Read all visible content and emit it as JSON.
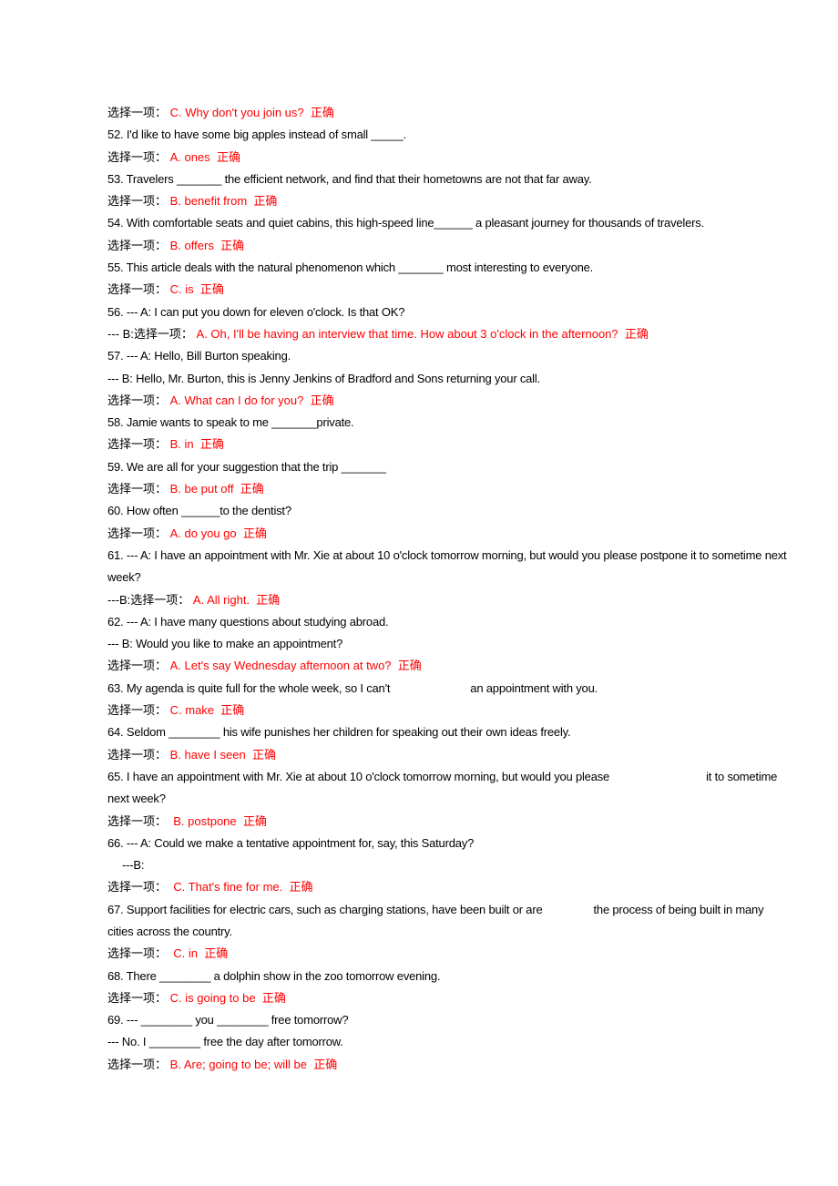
{
  "document": {
    "language_label": "选择一项：",
    "correct_mark": "正确",
    "accent_color": "#ff0000",
    "text_color": "#000000",
    "background_color": "#ffffff"
  },
  "lines": [
    {
      "id": "answer-51",
      "type": "answer",
      "label": "选择一项：",
      "answer": "C. Why don't you join us?",
      "mark": "正确"
    },
    {
      "id": "question-52",
      "type": "question",
      "text": "52. I'd like to have some big apples instead of small _____."
    },
    {
      "id": "answer-52",
      "type": "answer",
      "label": "选择一项：",
      "answer": "A. ones",
      "mark": "正确"
    },
    {
      "id": "question-53",
      "type": "question",
      "text": "53. Travelers _______ the efficient network, and find that their hometowns are not that far away."
    },
    {
      "id": "answer-53",
      "type": "answer",
      "label": "选择一项：",
      "answer": "B. benefit from",
      "mark": "正确"
    },
    {
      "id": "question-54",
      "type": "question",
      "text": "54. With comfortable seats and quiet cabins, this high-speed line______ a pleasant journey for thousands of travelers."
    },
    {
      "id": "answer-54",
      "type": "answer",
      "label": "选择一项：",
      "answer": "B. offers",
      "mark": "正确"
    },
    {
      "id": "question-55",
      "type": "question",
      "text": "55. This article deals with the natural phenomenon which _______ most interesting to everyone."
    },
    {
      "id": "answer-55",
      "type": "answer",
      "label": "选择一项：",
      "answer": "C. is",
      "mark": "正确"
    },
    {
      "id": "question-56",
      "type": "question",
      "text": "56. --- A: I can put you down for eleven o'clock. Is that OK?"
    },
    {
      "id": "answer-56",
      "type": "answer-dialog",
      "prefix": "--- B:",
      "label": "选择一项：",
      "answer": "A. Oh, I'll be having an interview that time. How about 3 o'clock in the afternoon?",
      "mark": "正确"
    },
    {
      "id": "question-57",
      "type": "question",
      "text": "57. --- A: Hello, Bill Burton speaking."
    },
    {
      "id": "question-57b",
      "type": "question",
      "text": "--- B: Hello, Mr. Burton, this is Jenny Jenkins of Bradford and Sons returning your call."
    },
    {
      "id": "answer-57",
      "type": "answer",
      "label": "选择一项：",
      "answer": "A. What can I do for you?",
      "mark": "正确"
    },
    {
      "id": "question-58",
      "type": "question",
      "text": "58. Jamie wants to speak to me _______private."
    },
    {
      "id": "answer-58",
      "type": "answer",
      "label": "选择一项：",
      "answer": "B. in",
      "mark": "正确"
    },
    {
      "id": "question-59",
      "type": "question",
      "text": "59. We are all for your suggestion that the trip _______"
    },
    {
      "id": "answer-59",
      "type": "answer",
      "label": "选择一项：",
      "answer": "B. be put off",
      "mark": "正确"
    },
    {
      "id": "question-60",
      "type": "question",
      "text": "60. How often ______to the dentist?"
    },
    {
      "id": "answer-60",
      "type": "answer",
      "label": "选择一项：",
      "answer": "A. do you go",
      "mark": "正确"
    },
    {
      "id": "question-61",
      "type": "question",
      "text": "61. --- A: I have an appointment with Mr. Xie at about 10 o'clock tomorrow morning, but would you please postpone it to sometime next week?"
    },
    {
      "id": "answer-61",
      "type": "answer-dialog",
      "prefix": "---B:",
      "label": "选择一项：",
      "answer": "A. All right.",
      "mark": "正确"
    },
    {
      "id": "question-62",
      "type": "question",
      "text": "62. --- A: I have many questions about studying abroad."
    },
    {
      "id": "question-62b",
      "type": "question",
      "text": "--- B: Would you like to make an appointment?"
    },
    {
      "id": "answer-62",
      "type": "answer",
      "label": "选择一项：",
      "answer": "A. Let's say Wednesday afternoon at two?",
      "mark": "正确"
    },
    {
      "id": "question-63",
      "type": "question-gap",
      "text_before": "63. My agenda is quite full for the whole week, so I can't",
      "text_after": "an appointment with you.",
      "gap": "md"
    },
    {
      "id": "answer-63",
      "type": "answer",
      "label": "选择一项：",
      "answer": "C. make",
      "mark": "正确"
    },
    {
      "id": "question-64",
      "type": "question",
      "text": "64. Seldom ________ his wife punishes her children for speaking out their own ideas freely."
    },
    {
      "id": "answer-64",
      "type": "answer",
      "label": "选择一项：",
      "answer": "B. have I seen",
      "mark": "正确"
    },
    {
      "id": "question-65",
      "type": "question-gap",
      "text_before": "65. I have an appointment with Mr. Xie at about 10 o'clock tomorrow morning, but would you please",
      "text_after": "it to sometime next week?",
      "gap": "lg"
    },
    {
      "id": "answer-65",
      "type": "answer-spaced",
      "label": "选择一项：",
      "answer": "B. postpone",
      "mark": "正确"
    },
    {
      "id": "question-66",
      "type": "question",
      "text": "66. --- A: Could we make a tentative appointment for, say, this Saturday?"
    },
    {
      "id": "question-66b",
      "type": "question-indent",
      "text": "---B:"
    },
    {
      "id": "answer-66",
      "type": "answer-spaced",
      "label": "选择一项：",
      "answer": "C. That's fine for me.",
      "mark": "正确"
    },
    {
      "id": "question-67",
      "type": "question-gap",
      "text_before": "67. Support facilities for electric cars, such as charging stations, have been built or are",
      "text_after": "the process of being built in many cities across the country.",
      "gap": "sm"
    },
    {
      "id": "answer-67",
      "type": "answer-spaced",
      "label": "选择一项：",
      "answer": "C. in",
      "mark": "正确"
    },
    {
      "id": "question-68",
      "type": "question",
      "text": "68. There ________ a dolphin show in the zoo tomorrow evening."
    },
    {
      "id": "answer-68",
      "type": "answer",
      "label": "选择一项：",
      "answer": "C. is going to be",
      "mark": "正确"
    },
    {
      "id": "question-69",
      "type": "question",
      "text": "69. --- ________ you ________ free tomorrow?"
    },
    {
      "id": "question-69b",
      "type": "question",
      "text": "--- No. I ________ free the day after tomorrow."
    },
    {
      "id": "answer-69",
      "type": "answer",
      "label": "选择一项：",
      "answer": "B. Are; going to be; will be",
      "mark": "正确"
    }
  ]
}
